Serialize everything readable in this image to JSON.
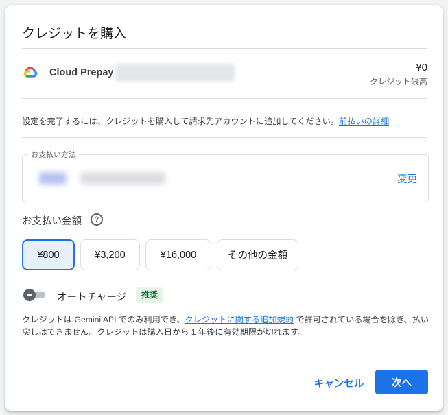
{
  "dialog": {
    "title": "クレジットを購入"
  },
  "account": {
    "logo_icon": "google-cloud-logo",
    "name": "Cloud Prepay",
    "balance": "¥0",
    "balance_label": "クレジット残高"
  },
  "info": {
    "text": "設定を完了するには、クレジットを購入して請求先アカウントに追加してください。",
    "link": "前払いの詳細"
  },
  "payment": {
    "legend": "お支払い方法",
    "change_label": "変更"
  },
  "amount": {
    "label": "お支払い金額",
    "help_icon": "help-circle-icon",
    "options": [
      "¥800",
      "¥3,200",
      "¥16,000",
      "その他の金額"
    ],
    "selected_index": 0
  },
  "autocharge": {
    "label": "オートチャージ",
    "badge": "推奨",
    "enabled": false
  },
  "disclaimer": {
    "part1": "クレジットは Gemini API でのみ利用でき、",
    "link": "クレジットに関する追加規約",
    "part2": " で許可されている場合を除き、払い戻しはできません。クレジットは購入日から 1 年後に有効期限が切れます。"
  },
  "footer": {
    "cancel_label": "キャンセル",
    "next_label": "次へ"
  },
  "colors": {
    "accent": "#1a73e8",
    "selected_bg": "#e8f0fe",
    "badge_bg": "#e6f4ea",
    "badge_text": "#137333"
  }
}
